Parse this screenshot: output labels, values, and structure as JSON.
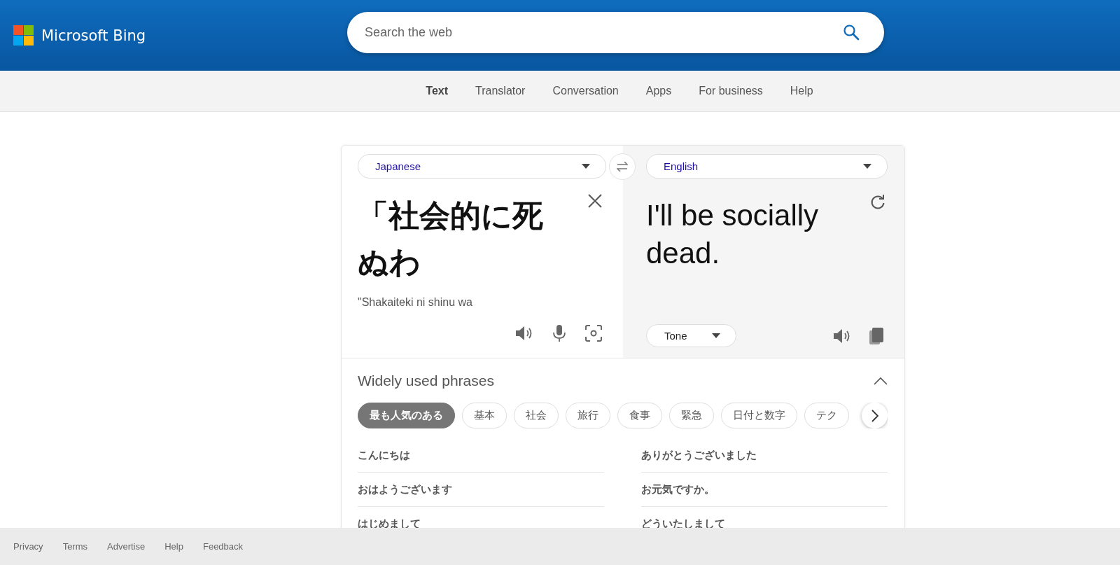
{
  "header": {
    "logo_text": "Microsoft Bing",
    "search": {
      "placeholder": "Search the web"
    }
  },
  "nav": [
    {
      "label": "Text",
      "selected": true
    },
    {
      "label": "Translator",
      "selected": false
    },
    {
      "label": "Conversation",
      "selected": false
    },
    {
      "label": "Apps",
      "selected": false
    },
    {
      "label": "For business",
      "selected": false
    },
    {
      "label": "Help",
      "selected": false
    }
  ],
  "translator": {
    "source": {
      "language": "Japanese",
      "text": "「社会的に死ぬわ",
      "romanization": "\"Shakaiteki ni shinu wa"
    },
    "target": {
      "language": "English",
      "text": "I'll be socially dead.",
      "tone": "Tone"
    }
  },
  "phrases": {
    "title": "Widely used phrases",
    "expanded": true,
    "categories": [
      {
        "label": "最も人気のある",
        "selected": true
      },
      {
        "label": "基本",
        "selected": false
      },
      {
        "label": "社会",
        "selected": false
      },
      {
        "label": "旅行",
        "selected": false
      },
      {
        "label": "食事",
        "selected": false
      },
      {
        "label": "緊急",
        "selected": false
      },
      {
        "label": "日付と数字",
        "selected": false
      },
      {
        "label": "テク",
        "selected": false
      }
    ],
    "items": [
      "こんにちは",
      "ありがとうございました",
      "おはようございます",
      "お元気ですか。",
      "はじめまして",
      "どういたしまして"
    ]
  },
  "footer": [
    "Privacy",
    "Terms",
    "Advertise",
    "Help",
    "Feedback"
  ]
}
